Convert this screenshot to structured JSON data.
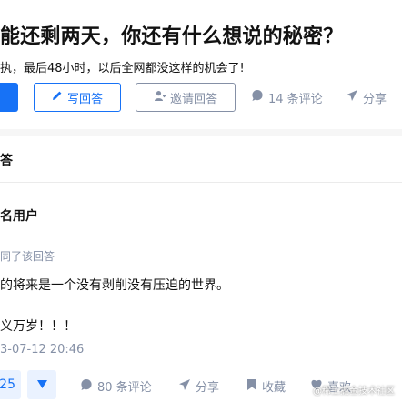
{
  "question": {
    "title": "能还剩两天，你还有什么想说的秘密？",
    "description": "执，最后48小时，以后全网都没这样的机会了!"
  },
  "actions": {
    "write_answer": "写回答",
    "invite_answer": "邀请回答",
    "comments": "14 条评论",
    "share": "分享"
  },
  "answers_header": {
    "title": "答"
  },
  "answer": {
    "author": "名用户",
    "agree_note": "同了该回答",
    "paragraph1": "的将来是一个没有剥削没有压迫的世界。",
    "paragraph2": "义万岁！！！",
    "timestamp": "3-07-12 20:46",
    "votes": "25",
    "comments": "80 条评论",
    "share": "分享",
    "favorite": "收藏",
    "like": "喜欢"
  },
  "watermark": "@稀土掘金技术社区",
  "colors": {
    "accent": "#1772f6",
    "muted": "#8590a6",
    "background": "#f6f6f6"
  }
}
